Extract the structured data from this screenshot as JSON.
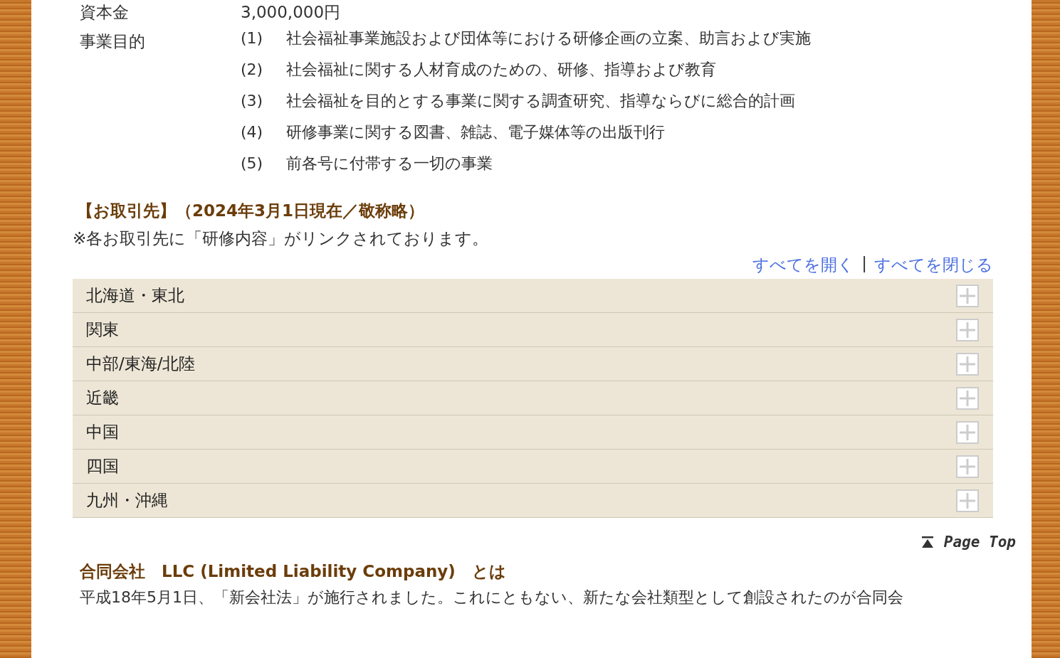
{
  "info_rows": [
    {
      "label": "資本金",
      "values": [
        "3,000,000円"
      ]
    },
    {
      "label": "事業目的",
      "values": [
        {
          "number": "(1)",
          "text": "社会福祉事業施設および団体等における研修企画の立案、助言および実施"
        },
        {
          "number": "(2)",
          "text": "社会福祉に関する人材育成のための、研修、指導および教育"
        },
        {
          "number": "(3)",
          "text": "社会福祉を目的とする事業に関する調査研究、指導ならびに総合的計画"
        },
        {
          "number": "(4)",
          "text": "研修事業に関する図書、雑誌、電子媒体等の出版刊行"
        },
        {
          "number": "(5)",
          "text": "前各号に付帯する一切の事業"
        }
      ]
    }
  ],
  "clients": {
    "heading": "【お取引先】（2024年3月1日現在／敬称略）",
    "note": "※各お取引先に「研修内容」がリンクされております。",
    "expand_all": "すべてを開く",
    "separator": "|",
    "collapse_all": "すべてを閉じる",
    "regions": [
      {
        "label": "北海道・東北",
        "expanded": false
      },
      {
        "label": "関東",
        "expanded": false
      },
      {
        "label": "中部/東海/北陸",
        "expanded": false
      },
      {
        "label": "近畿",
        "expanded": false
      },
      {
        "label": "中国",
        "expanded": false
      },
      {
        "label": "四国",
        "expanded": false
      },
      {
        "label": "九州・沖縄",
        "expanded": false
      }
    ]
  },
  "page_top": "Page Top",
  "llc": {
    "heading": "合同会社　LLC (Limited Liability Company)　とは",
    "paragraph": "平成18年5月1日、「新会社法」が施行されました。これにともない、新たな会社類型として創設されたのが合同会"
  }
}
